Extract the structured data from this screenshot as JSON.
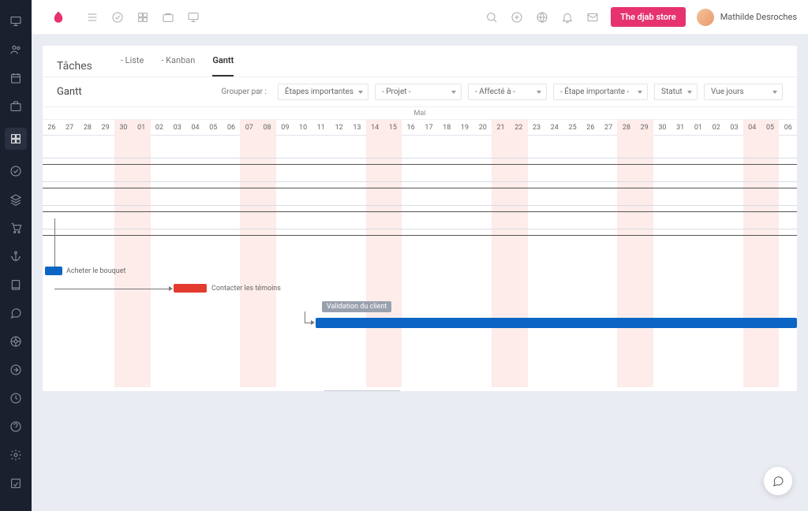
{
  "header": {
    "storeBtn": "The djab store",
    "userName": "Mathilde Desroches"
  },
  "tabs": {
    "title": "Tâches",
    "liste": "- Liste",
    "kanban": "- Kanban",
    "gantt": "Gantt"
  },
  "filters": {
    "ganttLabel": "Gantt",
    "groupBy": "Grouper par :",
    "milestones": "Étapes importantes",
    "project": "- Projet -",
    "assigned": "- Affecté à -",
    "milestone": "- Étape importante -",
    "status": "Statut",
    "view": "Vue jours"
  },
  "timeline": {
    "month": "Mai",
    "days": [
      "26",
      "27",
      "28",
      "29",
      "30",
      "01",
      "02",
      "03",
      "04",
      "05",
      "06",
      "07",
      "08",
      "09",
      "10",
      "11",
      "12",
      "13",
      "14",
      "15",
      "16",
      "17",
      "18",
      "19",
      "20",
      "21",
      "22",
      "23",
      "24",
      "25",
      "26",
      "27",
      "28",
      "29",
      "30",
      "31",
      "01",
      "02",
      "03",
      "04",
      "05",
      "06"
    ]
  },
  "tasks": {
    "bouquet": "Acheter le bouquet",
    "temoins": "Contacter les témoins",
    "validation": "Validation du client"
  }
}
